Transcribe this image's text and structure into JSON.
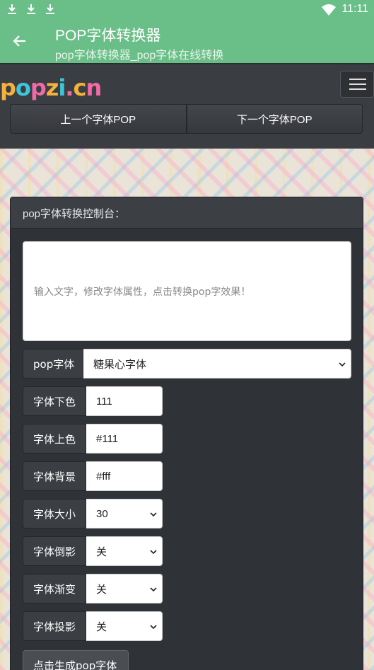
{
  "status_bar": {
    "time": "11:11",
    "icons": [
      "download-icon",
      "download-icon",
      "download-icon",
      "wifi-icon"
    ]
  },
  "app_bar": {
    "title": "POP字体转换器",
    "subtitle": "pop字体转换器_pop字体在线转换"
  },
  "site": {
    "logo": [
      "p",
      "o",
      "p",
      "z",
      "i",
      ".",
      "c",
      "n"
    ],
    "logo_colors": [
      "#f4b23c",
      "#3ec6d8",
      "#f06aa6",
      "#f4b23c",
      "#3ec6d8",
      "#f06aa6",
      "#f4b23c",
      "#f06aa6"
    ],
    "prev_label": "上一个字体POP",
    "next_label": "下一个字体POP"
  },
  "panel": {
    "title": "pop字体转换控制台：",
    "textarea_placeholder": "输入文字，修改字体属性，点击转换pop字效果！",
    "fields": [
      {
        "label": "pop字体",
        "value": "糖果心字体"
      },
      {
        "label": "字体下色",
        "value": "111"
      },
      {
        "label": "字体上色",
        "value": "#111"
      },
      {
        "label": "字体背景",
        "value": "#fff"
      },
      {
        "label": "字体大小",
        "value": "30"
      },
      {
        "label": "字体倒影",
        "value": "关"
      },
      {
        "label": "字体渐变",
        "value": "关"
      },
      {
        "label": "字体投影",
        "value": "关"
      }
    ],
    "generate_label": "点击生成pop字体"
  }
}
